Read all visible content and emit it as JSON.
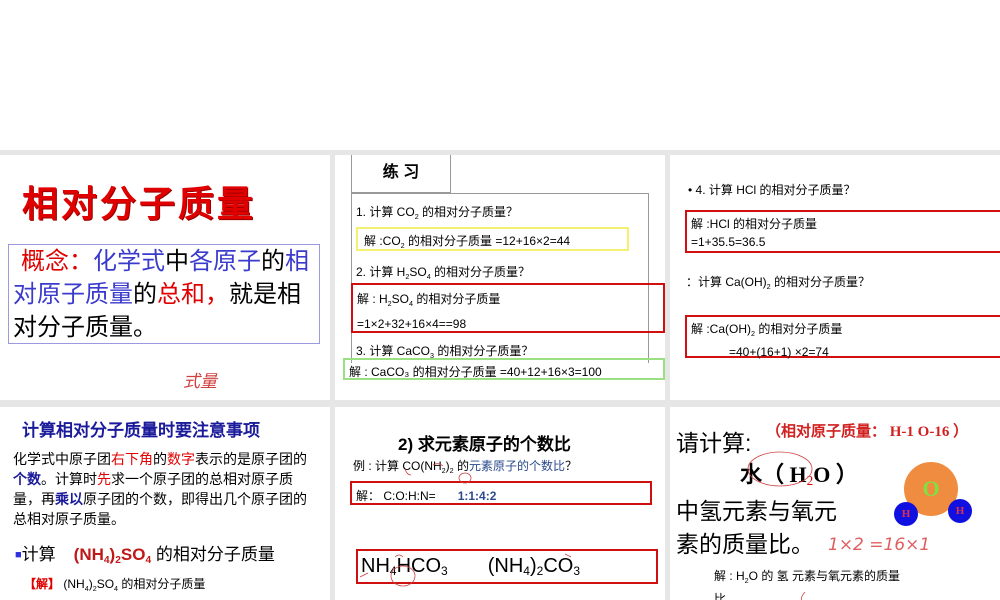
{
  "slide1": {
    "title": "相对分子质量",
    "concept_label": "概念：",
    "c1": "化学式",
    "c2": "中",
    "c3": "各原子",
    "c4": "的",
    "c5": "相对原子质量",
    "c6": "的",
    "c7": "总和，",
    "c8": "就",
    "c9": "是相对分子质量。",
    "handwriting": "式量"
  },
  "slide2": {
    "header": "练 习",
    "q1a": "1. 计算 CO",
    "q1s": "2",
    "q1b": " 的相对分子质量？",
    "a1a": "解 :CO",
    "a1s": "2",
    "a1b": " 的相对分子质量 =12+16×2=44",
    "q2a": "2. 计算 H",
    "q2s1": "2",
    "q2m": "SO",
    "q2s2": "4",
    "q2b": " 的相对分子质量？",
    "a2a": "解 : H",
    "a2s1": "2",
    "a2m": "SO",
    "a2s2": "4",
    "a2b": " 的相对分子质量",
    "a2c": "=1×2+32+16×4==98",
    "q3a": "3. 计算 CaCO",
    "q3s": "3",
    "q3b": " 的相对分子质量？",
    "a3": "解 : CaCO₃ 的相对分子质量 =40+12+16×3=100"
  },
  "slide3": {
    "q4": "4. 计算 HCl 的相对分子质量？",
    "a4a": "解 :HCl 的相对分子质量",
    "a4b": "=1+35.5=36.5",
    "q5a": "：计算 Ca(OH)",
    "q5s": "2",
    "q5b": " 的相对分子质量？",
    "a5a": "解 :Ca(OH)",
    "a5s": "2",
    "a5b": " 的相对分子质量",
    "a5c": "=40+(16+1) ×2=74"
  },
  "slide4": {
    "title": "计算相对分子质量时要注意事项",
    "p1": "化学式中原子团",
    "p2": "右下角",
    "p3": "的",
    "p4": "数字",
    "p5": "表示的是原子团的",
    "p6": "个数",
    "p7": "。计算时",
    "p8": "先",
    "p9": "求一个原子团的总相对原子质量，再",
    "p10": "乘以",
    "p11": "原子团的个数，即得出几个原子团的总相对原子质量。",
    "calc_label": "计算",
    "f1": "(NH",
    "f2": "4",
    "f3": ")",
    "f4": "2",
    "f5": "SO",
    "f6": "4",
    "calc_tail": " 的相对分子质量",
    "sol_label": "【解】",
    "sol_a": "(NH",
    "sol_b": "4",
    "sol_c": ")",
    "sol_d": "2",
    "sol_e": "SO",
    "sol_f": "4",
    "sol_tail": " 的相对分子质量"
  },
  "slide5": {
    "title": "2) 求元素原子的个数比",
    "ex_a": "例 : 计算 CO(NH",
    "ex_s1": "2",
    "ex_m": ")",
    "ex_s2": "2",
    "ex_b": " 的",
    "ex_c": "元素原子的个数比",
    "ex_d": "？",
    "sol": "解：  C:O:H:N=",
    "ratio": "1:1:4:2",
    "f1a": "NH",
    "f1s": "4",
    "f1b": "HCO",
    "f1s2": "3",
    "f2a": "(NH",
    "f2s": "4",
    "f2b": ")",
    "f2s2": "2",
    "f2c": "CO",
    "f2s3": "3"
  },
  "slide6": {
    "title": "请计算:",
    "note": "（相对原子质量：  H-1  O-16 ）",
    "water_a": "水（ H",
    "water_s": "2",
    "water_b": "O ）",
    "line1": "中氢元素与氧元",
    "line2": "素的质量比。",
    "handwriting": "1×2 =16×1",
    "o_label": "O",
    "h_label": "H",
    "sol_a": "解 : H",
    "sol_s": "2",
    "sol_b": "O 的  氢  元素与氧元素的质量",
    "sol_c": "比"
  }
}
